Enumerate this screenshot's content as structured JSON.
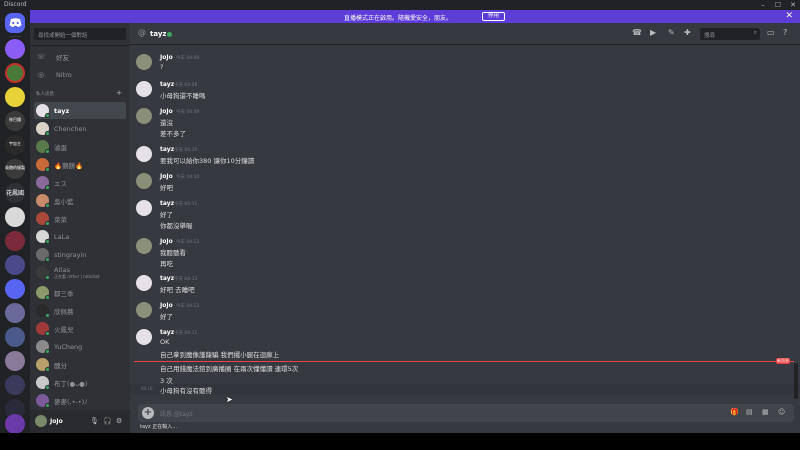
{
  "titlebar": {
    "app": "Discord",
    "min": "–",
    "max": "☐",
    "close": "✕"
  },
  "banner": {
    "text": "直播模式正在啟用。隨機愛安全，朋友。",
    "button": "停用",
    "close": "✕",
    "color": "#5d3dd8"
  },
  "guilds": {
    "home_icon": "discord-logo-icon",
    "labels": [
      "修巴鐵",
      "宇宙主",
      "吸飽的服製",
      "花鳳國"
    ]
  },
  "dm": {
    "search_placeholder": "尋找或開始一個對話",
    "nav": [
      {
        "label": "好友",
        "icon": "friends-icon"
      },
      {
        "label": "Nitro",
        "icon": "nitro-icon"
      }
    ],
    "header": "私人訊息",
    "add": "+",
    "items": [
      {
        "name": "tayz",
        "sub": "",
        "active": true,
        "color": "#e6e0e8"
      },
      {
        "name": "Chenchen",
        "sub": "",
        "active": false,
        "color": "#d9d3c8"
      },
      {
        "name": "滷蛋",
        "sub": "",
        "active": false,
        "color": "#5a7a4a"
      },
      {
        "name": "🔥鵝鵝🔥",
        "sub": "",
        "active": false,
        "color": "#c86a3a"
      },
      {
        "name": "エス",
        "sub": "",
        "active": false,
        "color": "#8a6a9a"
      },
      {
        "name": "吳小藍",
        "sub": "",
        "active": false,
        "color": "#c98a6a"
      },
      {
        "name": "菜菜",
        "sub": "",
        "active": false,
        "color": "#a8483a"
      },
      {
        "name": "LaLa",
        "sub": "",
        "active": false,
        "color": "#d7d7d7"
      },
      {
        "name": "stingrayin",
        "sub": "",
        "active": false,
        "color": "#6a6a6a"
      },
      {
        "name": "Atlas",
        "sub": "正在看 /other | ratkcket",
        "active": false,
        "color": "#3a3a3a"
      },
      {
        "name": "鄒三季",
        "sub": "",
        "active": false,
        "color": "#8a9a6a"
      },
      {
        "name": "欣佩蕎",
        "sub": "",
        "active": false,
        "color": "#2a2a2a"
      },
      {
        "name": "火鳳兒",
        "sub": "",
        "active": false,
        "color": "#a03a3a"
      },
      {
        "name": "YuCheng",
        "sub": "",
        "active": false,
        "color": "#8a8a8a"
      },
      {
        "name": "醜分",
        "sub": "",
        "active": false,
        "color": "#b8a06a"
      },
      {
        "name": "布丁(●ᴗ●)",
        "sub": "",
        "active": false,
        "color": "#c9c9c9"
      },
      {
        "name": "麥麥(⁠,⁠•⁠-⁠•⁠)ﾉ",
        "sub": "",
        "active": false,
        "color": "#7a5a9a"
      }
    ]
  },
  "user": {
    "name": "JoJo",
    "mic_icon": "mic-icon",
    "headset_icon": "headset-icon",
    "settings_icon": "gear-icon"
  },
  "channel": {
    "name": "tayz",
    "search_placeholder": "搜尋",
    "header_icons": [
      "call-icon",
      "video-icon",
      "pin-icon",
      "add-member-icon",
      "inbox-icon",
      "help-icon"
    ]
  },
  "messages": [
    {
      "author": "JoJo",
      "time": "今天 04:08",
      "lines": [
        "?"
      ]
    },
    {
      "author": "tayz",
      "time": "今天 04:08",
      "lines": [
        "小母狗還不睡嗎"
      ]
    },
    {
      "author": "JoJo",
      "time": "今天 04:09",
      "lines": [
        "還沒",
        "差不多了"
      ]
    },
    {
      "author": "tayz",
      "time": "今天 04:10",
      "lines": [
        "要我可以給你380 讓你10分鐘讀"
      ]
    },
    {
      "author": "JoJo",
      "time": "今天 04:10",
      "lines": [
        "好吧"
      ]
    },
    {
      "author": "tayz",
      "time": "今天 04:11",
      "lines": [
        "好了",
        "你都沒舉喔"
      ]
    },
    {
      "author": "JoJo",
      "time": "今天 04:13",
      "lines": [
        "我聽聽看",
        "再吃"
      ]
    },
    {
      "author": "tayz",
      "time": "今天 04:13",
      "lines": [
        "好吧 去睡吧"
      ]
    },
    {
      "author": "JoJo",
      "time": "今天 04:13",
      "lines": [
        "好了"
      ]
    },
    {
      "author": "tayz",
      "time": "今天 04:15",
      "lines": [
        "OK",
        "自己拿到魔像護龍騙 我們擺小腿在迴廊上"
      ]
    }
  ],
  "new_tag": "新訊息",
  "after_new": [
    {
      "time": "",
      "text": "自己用錢魔法鎧到廣播圈 在兩次懂懂讀  連環5次"
    },
    {
      "time": "",
      "text": "3 次"
    },
    {
      "time": "04:16",
      "text": "小母狗有沒有聽得"
    }
  ],
  "composer": {
    "placeholder": "訊息 @tayz",
    "icons": [
      "gift-icon",
      "gif-icon",
      "sticker-icon",
      "emoji-icon"
    ]
  },
  "typing": "tayz 正在輸入..."
}
